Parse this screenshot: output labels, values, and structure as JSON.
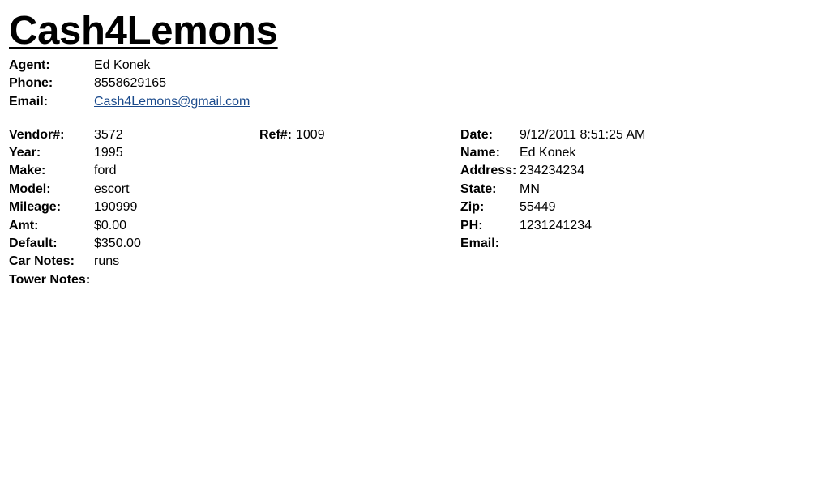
{
  "brand": "Cash4Lemons",
  "agent": {
    "agent_label": "Agent:",
    "agent_value": "Ed Konek",
    "phone_label": "Phone:",
    "phone_value": "8558629165",
    "email_label": "Email:",
    "email_value": "Cash4Lemons@gmail.com"
  },
  "vehicle": {
    "vendor_label": "Vendor#:",
    "vendor_value": "3572",
    "year_label": "Year:",
    "year_value": "1995",
    "make_label": "Make:",
    "make_value": "ford",
    "model_label": "Model:",
    "model_value": "escort",
    "mileage_label": "Mileage:",
    "mileage_value": "190999",
    "amt_label": "Amt:",
    "amt_value": "$0.00",
    "default_label": "Default:",
    "default_value": "$350.00",
    "car_notes_label": "Car Notes:",
    "car_notes_value": "runs",
    "tower_notes_label": "Tower Notes:",
    "tower_notes_value": ""
  },
  "ref": {
    "label": "Ref#:",
    "value": "1009"
  },
  "customer": {
    "date_label": "Date:",
    "date_value": "9/12/2011 8:51:25 AM",
    "name_label": "Name:",
    "name_value": "Ed Konek",
    "address_label": "Address:",
    "address_value": "234234234",
    "state_label": "State:",
    "state_value": "MN",
    "zip_label": "Zip:",
    "zip_value": "55449",
    "ph_label": "PH:",
    "ph_value": "1231241234",
    "email_label": "Email:",
    "email_value": ""
  },
  "colors": {
    "link": "#1a4a8c",
    "text": "#000000",
    "background": "#ffffff"
  }
}
